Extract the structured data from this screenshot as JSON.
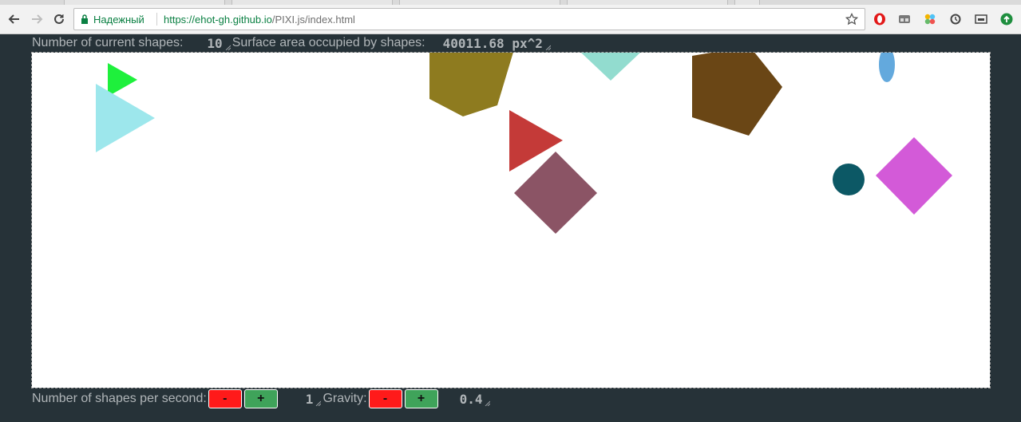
{
  "browser": {
    "secure_label": "Надежный",
    "url_host": "https://ehot-gh.github.io",
    "url_path": "/PIXI.js/index.html"
  },
  "header": {
    "shapes_label": "Number of current shapes:",
    "shapes_value": "10",
    "area_label": "Surface area occupied by shapes:",
    "area_value": "40011.68 px^2"
  },
  "footer": {
    "rate_label": "Number of shapes per second:",
    "rate_minus": "-",
    "rate_plus": "+",
    "rate_value": "1",
    "gravity_label": "Gravity:",
    "gravity_minus": "-",
    "gravity_plus": "+",
    "gravity_value": "0.4"
  },
  "shapes": [
    {
      "kind": "triangle",
      "color": "#1ef03c"
    },
    {
      "kind": "triangle",
      "color": "#9de7ec"
    },
    {
      "kind": "pentagon",
      "color": "#8e7b1f"
    },
    {
      "kind": "triangle",
      "color": "#92dccf"
    },
    {
      "kind": "triangle",
      "color": "#c43a38"
    },
    {
      "kind": "diamond",
      "color": "#8b5465"
    },
    {
      "kind": "pentagon",
      "color": "#6a4615"
    },
    {
      "kind": "ellipse",
      "color": "#63a9dd"
    },
    {
      "kind": "circle",
      "color": "#0c5865"
    },
    {
      "kind": "diamond",
      "color": "#d35ad8"
    }
  ]
}
